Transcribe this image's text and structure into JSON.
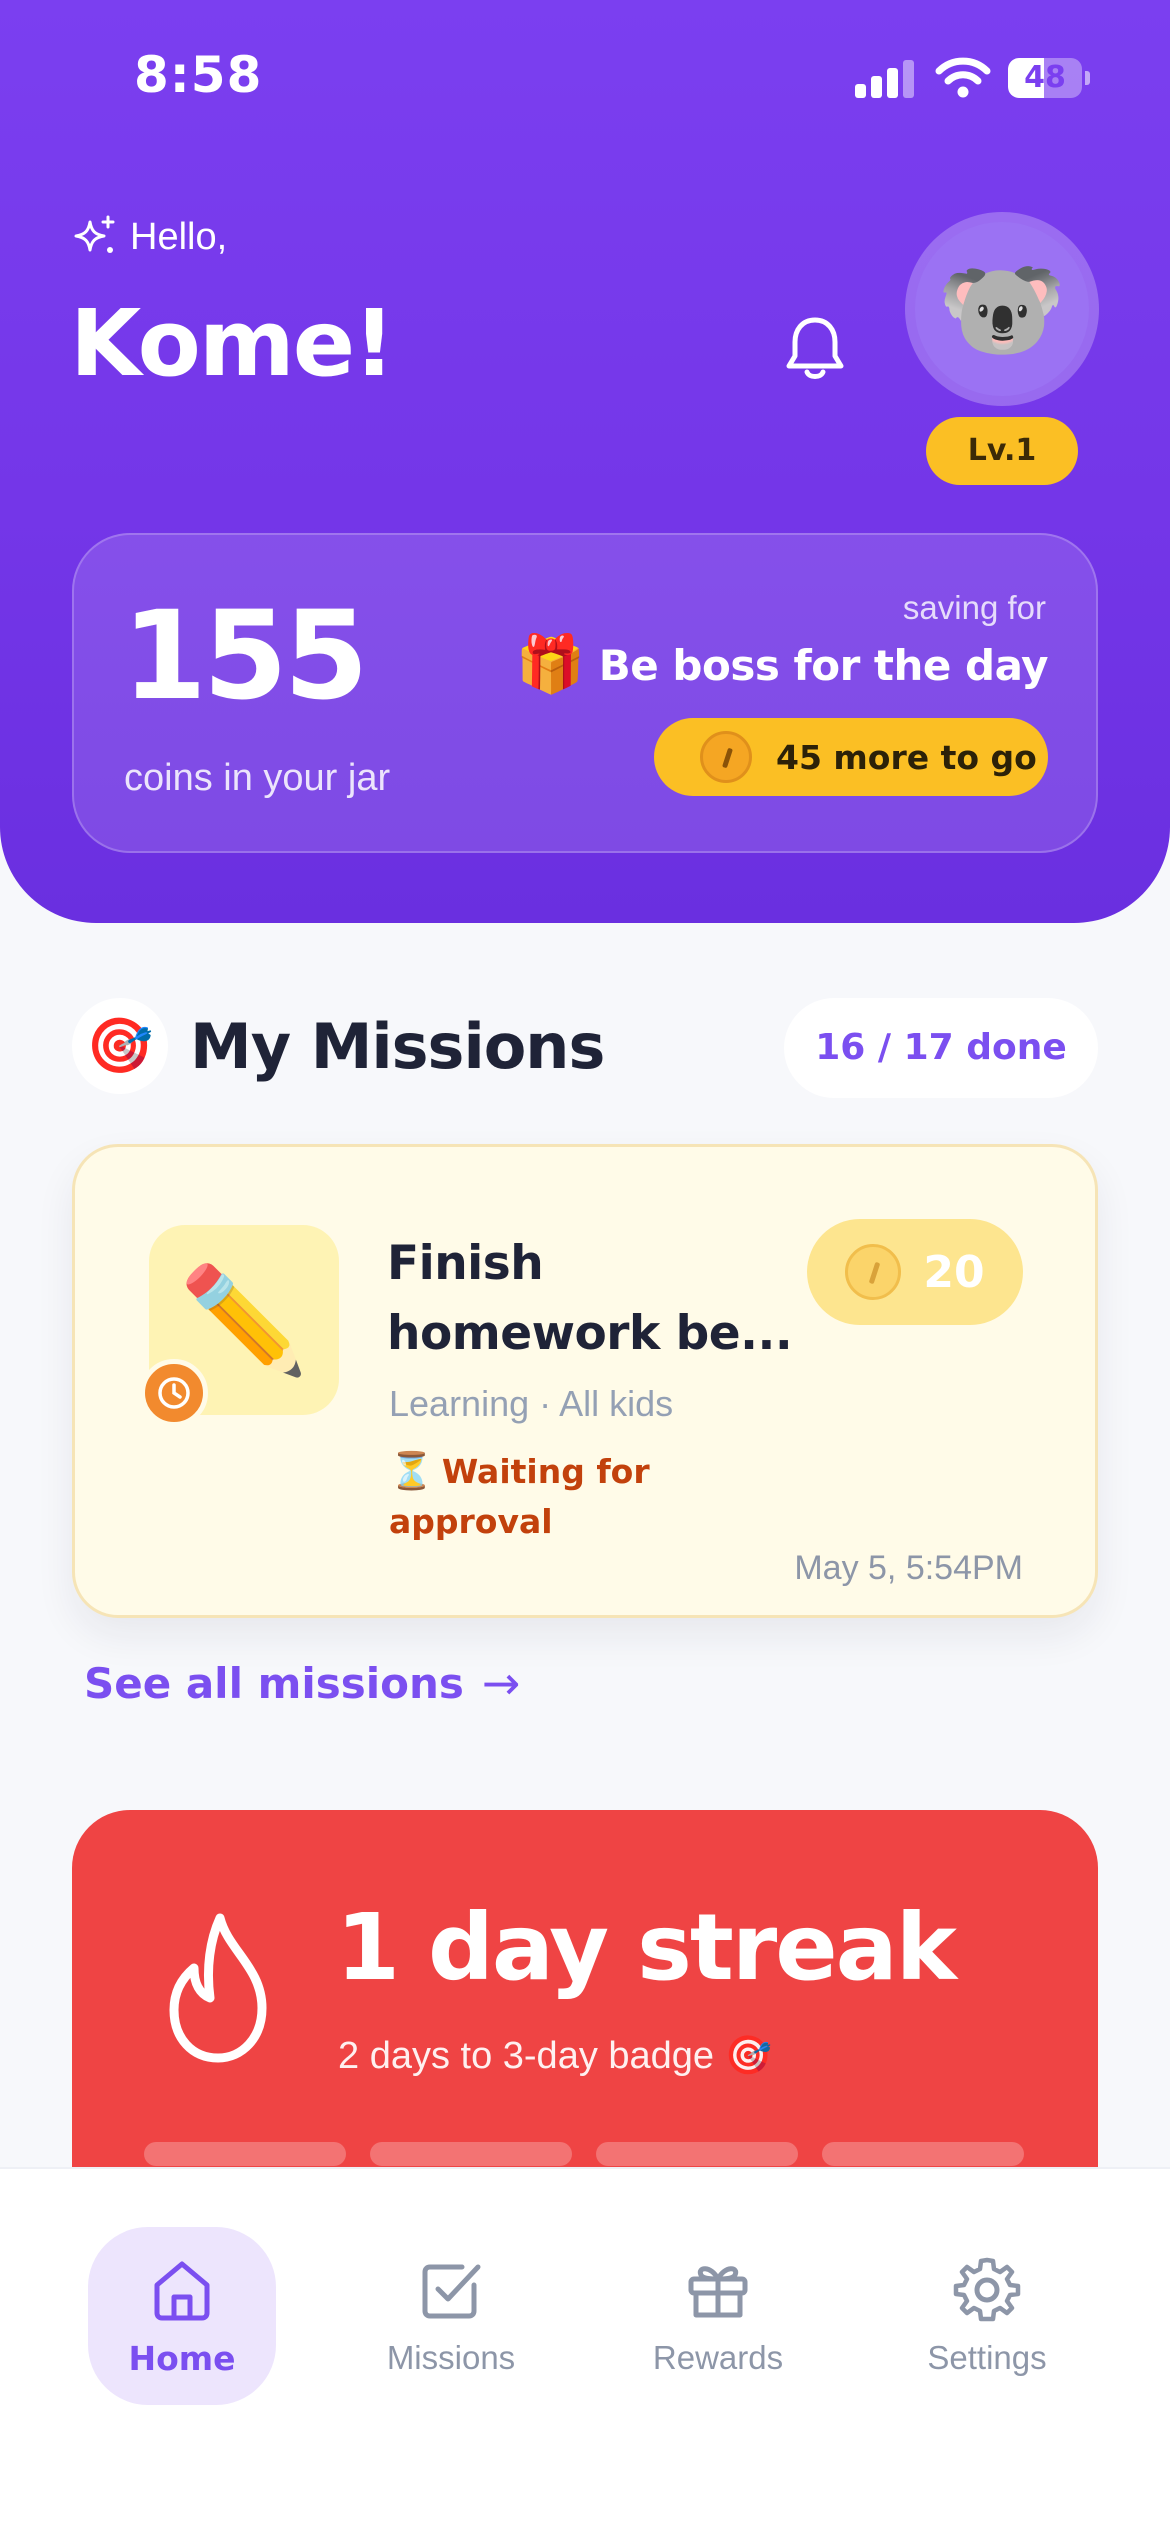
{
  "status_bar": {
    "time": "8:58",
    "battery": "48",
    "battery_level": 0.48
  },
  "header": {
    "greeting": "Hello,",
    "name": "Kome!",
    "avatar_emoji": "🐨",
    "level": "Lv.1",
    "icons": {
      "sparkle": "sparkles-icon",
      "bell": "bell-icon"
    }
  },
  "jar": {
    "coins": "155",
    "coins_label": "coins in your jar",
    "saving_label": "saving for",
    "goal_emoji": "🎁",
    "goal_name": "Be boss for the day",
    "remaining": "45 more to go"
  },
  "missions": {
    "title": "My Missions",
    "title_emoji": "🎯",
    "progress": "16 / 17 done",
    "items": [
      {
        "icon_emoji": "✏️",
        "title": "Finish homework be...",
        "meta": "Learning · All kids",
        "status_emoji": "⏳",
        "status": "Waiting for approval",
        "reward": "20",
        "date": "May 5, 5:54PM"
      }
    ],
    "see_all": "See all missions",
    "see_all_arrow": "→"
  },
  "streak": {
    "title": "1 day streak",
    "subtitle": "2 days to 3-day badge 🎯",
    "segments_filled": 0,
    "segments_total": 4
  },
  "tabs": [
    {
      "label": "Home",
      "icon": "home-icon",
      "active": true
    },
    {
      "label": "Missions",
      "icon": "checkbox-icon",
      "active": false
    },
    {
      "label": "Rewards",
      "icon": "gift-icon",
      "active": false
    },
    {
      "label": "Settings",
      "icon": "gear-icon",
      "active": false
    }
  ],
  "colors": {
    "primary": "#7b3ff0",
    "accent_yellow": "#fbbf24",
    "streak_red": "#ef4444",
    "pending_orange": "#c2410c",
    "text_dark": "#1f2337"
  }
}
